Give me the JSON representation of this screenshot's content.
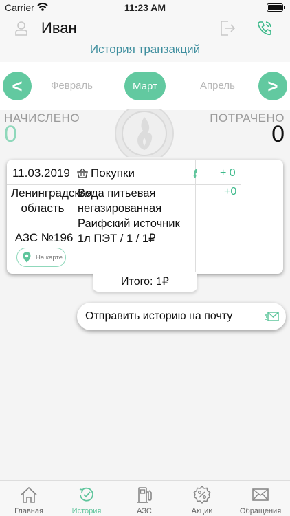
{
  "status_bar": {
    "carrier": "Carrier",
    "time": "11:23 AM"
  },
  "header": {
    "username": "Иван",
    "title": "История транзакций"
  },
  "months": {
    "prev_label": "<",
    "next_label": ">",
    "previous": "Февраль",
    "current": "Март",
    "next": "Апрель"
  },
  "summary": {
    "credited_label": "НАЧИСЛЕНО",
    "credited_value": "0",
    "spent_label": "ПОТРАЧЕНО",
    "spent_value": "0"
  },
  "transaction": {
    "date": "11.03.2019",
    "category": "Покупки",
    "bonus_total": "+ 0",
    "region": "Ленинградская область",
    "station": "АЗС №196",
    "map_button": "На карте",
    "product": "Вода питьевая негазированная Раифский источник 1л ПЭТ / 1 / 1₽",
    "bonus_line": "+0",
    "total": "Итого: 1₽"
  },
  "email_button": {
    "label": "Отправить историю на почту"
  },
  "tabbar": {
    "items": [
      {
        "label": "Главная",
        "icon": "home-icon"
      },
      {
        "label": "История",
        "icon": "history-icon",
        "active": true
      },
      {
        "label": "АЗС",
        "icon": "fuel-pump-icon"
      },
      {
        "label": "Акции",
        "icon": "discount-icon"
      },
      {
        "label": "Обращения",
        "icon": "envelope-icon"
      }
    ]
  },
  "colors": {
    "accent": "#62c9a0",
    "accent_light": "#8fd8bb",
    "bonus": "#3cb98a",
    "title": "#3e8e9e"
  }
}
